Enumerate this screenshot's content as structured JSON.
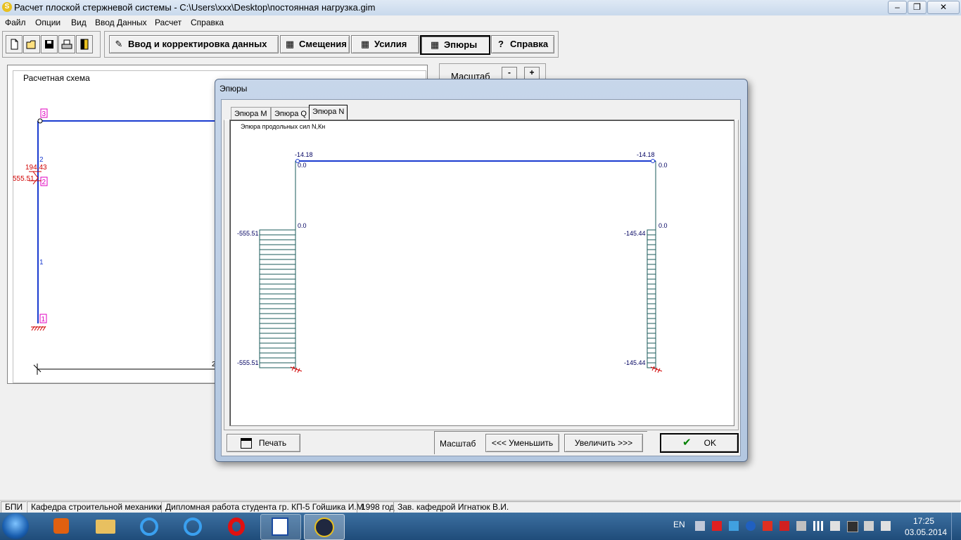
{
  "window": {
    "title": "Расчет плоской стержневой системы - C:\\Users\\xxx\\Desktop\\постоянная нагрузка.gim",
    "app_icon": "S",
    "min_glyph": "–",
    "max_glyph": "❐",
    "close_glyph": "✕"
  },
  "menu": [
    "Файл",
    "Опции",
    "Вид",
    "Ввод Данных",
    "Расчет",
    "Справка"
  ],
  "toolbar": {
    "file_icons": [
      "new-file-icon",
      "open-folder-icon",
      "save-disk-icon",
      "print-icon",
      "exit-door-icon"
    ],
    "nav": [
      {
        "label": "Ввод и корректировка данных",
        "icon": "✎"
      },
      {
        "label": "Смещения",
        "icon": "▦"
      },
      {
        "label": "Усилия",
        "icon": "▦"
      },
      {
        "label": "Эпюры",
        "icon": "▦"
      },
      {
        "label": "Справка",
        "icon": "?"
      }
    ]
  },
  "scheme": {
    "title": "Расчетная схема",
    "masshtab_label": "Масштаб",
    "minus": "-",
    "plus": "+",
    "node_labels": [
      "3",
      "2",
      "1"
    ],
    "member_labels": [
      "2",
      "1"
    ],
    "load_labels": [
      "194.43",
      "555.51"
    ],
    "axis_label": "2"
  },
  "dialog": {
    "title": "Эпюры",
    "tabs": [
      "Эпюра M",
      "Эпюра Q",
      "Эпюра N"
    ],
    "active_tab": "Эпюра N",
    "plot_title": "Эпюра продольных сил N,Кн",
    "labels": {
      "top_left": "-14.18",
      "top_right": "-14.18",
      "left_top_zero": "0.0",
      "right_top_zero": "0.0",
      "left_mid_zero": "0.0",
      "right_mid_zero": "0.0",
      "left_upper": "-555.51",
      "left_lower": "-555.51",
      "right_upper": "-145.44",
      "right_lower": "-145.44"
    },
    "print_label": "Печать",
    "scale_label": "Масштаб",
    "decrease_label": "<<<  Уменьшить",
    "increase_label": "Увеличить  >>>",
    "ok_label": "OK"
  },
  "status": [
    "БПИ",
    "Кафедра строительной механики",
    "Дипломная работа студента гр. КП-5 Гойшика И.М.",
    "1998 год",
    "Зав. кафедрой Игнатюк В.И."
  ],
  "taskbar": {
    "lang": "EN",
    "time": "17:25",
    "date": "03.05.2014",
    "apps": [
      "start-orb-icon",
      "media-player-icon",
      "file-explorer-icon",
      "ie-icon",
      "ie-icon",
      "opera-icon",
      "word-icon",
      "sirius-icon"
    ]
  }
}
